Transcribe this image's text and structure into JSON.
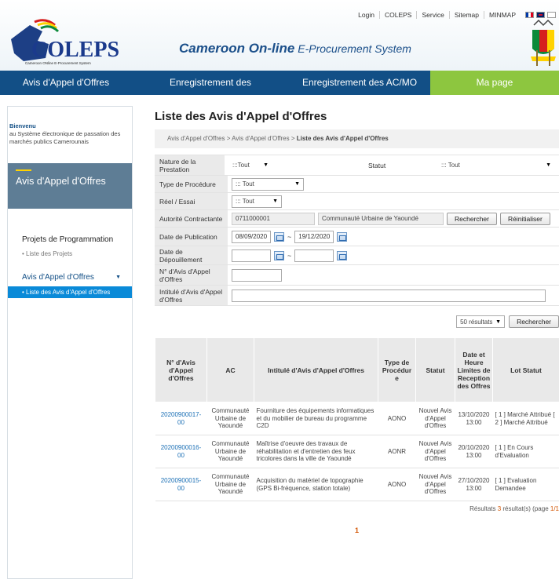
{
  "header": {
    "top_links": [
      "Login",
      "COLEPS",
      "Service",
      "Sitemap",
      "MINMAP"
    ],
    "logo_text": "COLEPS",
    "logo_subtext": "Cameroon ONline E-Procurement System",
    "title_bold": "Cameroon On-line",
    "title_rest": " E-Procurement System",
    "brand_color": "#124f86",
    "accent_color": "#8dc63f"
  },
  "nav": {
    "items": [
      "Avis d'Appel d'Offres",
      "Enregistrement des soumissionnaires",
      "Enregistrement des AC/MO",
      "Ma page"
    ]
  },
  "sidebar": {
    "welcome_title": "Bienvenu",
    "welcome_text": "au Système électronique de passation des marchés publics Camerounais",
    "section_title": "Avis d'Appel d'Offres",
    "group1": "Projets de Programmation",
    "group1_item": "• Liste des Projets",
    "group2": "Avis d'Appel d'Offres",
    "group2_item": "• Liste des Avis d'Appel d'Offres"
  },
  "main": {
    "title": "Liste des Avis d'Appel d'Offres",
    "breadcrumb_1": "Avis d'Appel d'Offres > Avis d'Appel d'Offres > ",
    "breadcrumb_current": "Liste des Avis d'Appel d'Offres"
  },
  "filters": {
    "nature_label": "Nature de la Prestation",
    "nature_value": ":::Tout",
    "statut_label": "Statut",
    "statut_value": "::: Tout",
    "procedure_label": "Type de Procédure",
    "procedure_value": "::: Tout",
    "reel_label": "Réel / Essai",
    "reel_value": "::: Tout",
    "autorite_label": "Autorité Contractante",
    "autorite_code": "0711000001",
    "autorite_name": "Communauté Urbaine de Yaoundé",
    "rechercher_label": "Rechercher",
    "reinitialiser_label": "Réinitialiser",
    "publication_label": "Date de Publication",
    "publication_from": "08/09/2020",
    "publication_to": "19/12/2020",
    "depouillement_label": "Date de Dépouillement",
    "numero_label": "N° d'Avis d'Appel d'Offres",
    "intitule_label": "Intitulé d'Avis d'Appel d'Offres",
    "separator": "~"
  },
  "results_controls": {
    "per_page": "50 résultats",
    "search_label": "Rechercher"
  },
  "table": {
    "headers": [
      "N° d'Avis d'Appel d'Offres",
      "AC",
      "Intitulé d'Avis d'Appel d'Offres",
      "Type de Procédur e",
      "Statut",
      "Date et Heure Limites de Reception des Offres",
      "Lot Statut"
    ],
    "rows": [
      [
        "20200900017-00",
        "Communauté Urbaine de Yaoundé",
        "Fourniture des équipements informatiques et du mobilier de bureau du programme C2D",
        "AONO",
        "Nouvel Avis d'Appel d'Offres",
        "13/10/2020 13:00",
        "[ 1 ] Marché Attribué [ 2 ] Marché Attribué"
      ],
      [
        "20200900016-00",
        "Communauté Urbaine de Yaoundé",
        "Maîtrise d'oeuvre des travaux de réhabilitation et d'entretien des feux tricolores dans la ville de Yaoundé",
        "AONR",
        "Nouvel Avis d'Appel d'Offres",
        "20/10/2020 13:00",
        "[ 1 ] En Cours d'Evaluation"
      ],
      [
        "20200900015-00",
        "Communauté Urbaine de Yaoundé",
        "Acquisition du matériel de topographie (GPS Bi-fréquence, station totale)",
        "AONO",
        "Nouvel Avis d'Appel d'Offres",
        "27/10/2020 13:00",
        "[ 1 ] Evaluation Demandee"
      ]
    ]
  },
  "summary": {
    "prefix": "Résultats ",
    "count": "3",
    "middle": " résultat(s) (page ",
    "page": "1/1",
    "pager_current": "1"
  }
}
